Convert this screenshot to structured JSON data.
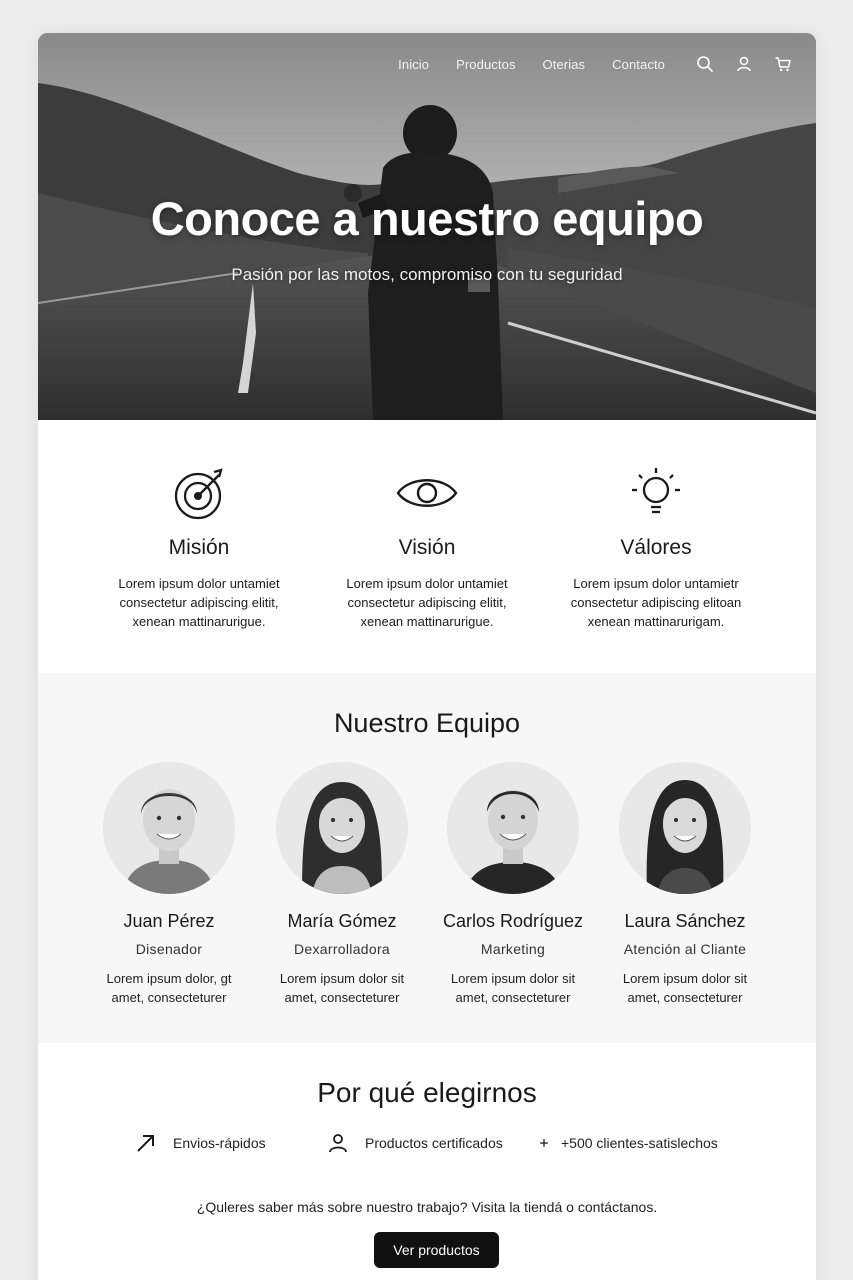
{
  "nav": {
    "links": [
      "Inicio",
      "Productos",
      "Oterias",
      "Contacto"
    ],
    "icons": [
      "search-icon",
      "user-icon",
      "cart-icon"
    ]
  },
  "hero": {
    "title": "Conoce a nuestro equipo",
    "subtitle": "Pasión por las motos, compromiso con tu seguridad"
  },
  "values": [
    {
      "icon": "target-icon",
      "title": "Misión",
      "lines": [
        "Lorem ipsum dolor untamiet",
        "consectetur adipiscing elitit,",
        "xenean mattinarurigue."
      ]
    },
    {
      "icon": "eye-icon",
      "title": "Visión",
      "lines": [
        "Lorem ipsum dolor untamiet",
        "consectetur adipiscing elitit,",
        "xenean mattinarurigue."
      ]
    },
    {
      "icon": "lightbulb-icon",
      "title": "Válores",
      "lines": [
        "Lorem ipsum dolor untamietr",
        "consectetur adipiscing elitoan",
        "xenean mattinarurigam."
      ]
    }
  ],
  "team": {
    "title": "Nuestro Equipo",
    "members": [
      {
        "name": "Juan Pérez",
        "role": "Disenador",
        "bio": [
          "Lorem ipsum dolor, gt",
          "amet, consecteturer"
        ]
      },
      {
        "name": "María Gómez",
        "role": "Dexarrolladora",
        "bio": [
          "Lorem ipsum dolor sit",
          "amet, consecteturer"
        ]
      },
      {
        "name": "Carlos Rodríguez",
        "role": "Marketing",
        "bio": [
          "Lorem ipsum dolor sit",
          "amet, consecteturer"
        ]
      },
      {
        "name": "Laura Sánchez",
        "role": "Atención al Cliante",
        "bio": [
          "Lorem ipsum dolor sit",
          "amet, consecteturer"
        ]
      }
    ]
  },
  "why": {
    "title": "Por qué elegirnos",
    "features": [
      {
        "icon": "arrow-up-right-icon",
        "label": "Envios-rápidos"
      },
      {
        "icon": "person-icon",
        "label": "Productos certificados"
      },
      {
        "icon": "plus-icon",
        "label": "+500 clientes-satislechos"
      }
    ],
    "cta_text": "¿Quleres saber más sobre nuestro trabajo? Visita la tiendá o contáctanos.",
    "cta_button": "Ver productos"
  }
}
